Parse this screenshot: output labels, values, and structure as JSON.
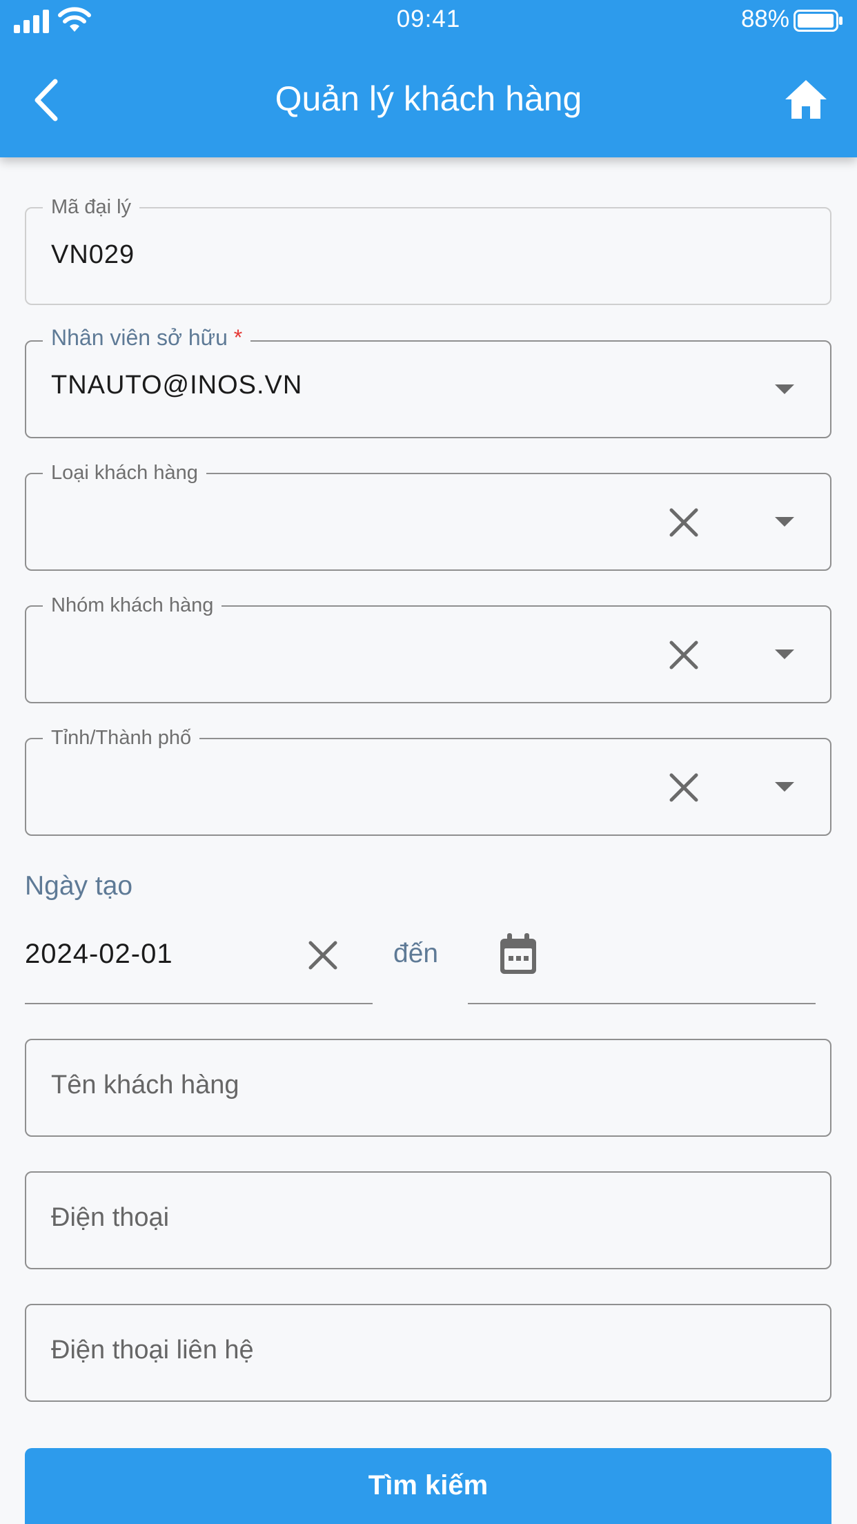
{
  "status_bar": {
    "time": "09:41",
    "battery": "88%"
  },
  "header": {
    "title": "Quản lý khách hàng"
  },
  "form": {
    "agent_code": {
      "label": "Mã đại lý",
      "value": "VN029"
    },
    "owner": {
      "label": "Nhân viên sở hữu",
      "required_mark": "*",
      "value": "TNAUTO@INOS.VN"
    },
    "customer_type": {
      "label": "Loại khách hàng",
      "value": ""
    },
    "customer_group": {
      "label": "Nhóm khách hàng",
      "value": ""
    },
    "province": {
      "label": "Tỉnh/Thành phố",
      "value": ""
    },
    "created_date": {
      "label": "Ngày tạo",
      "from": "2024-02-01",
      "separator": "đến",
      "to": ""
    },
    "customer_name": {
      "placeholder": "Tên khách hàng"
    },
    "phone": {
      "placeholder": "Điện thoại"
    },
    "contact_phone": {
      "placeholder": "Điện thoại liên hệ"
    },
    "search_button": "Tìm kiếm"
  },
  "colors": {
    "primary": "#2d9bec",
    "label_accent": "#5e7a96",
    "required": "#e53935"
  }
}
